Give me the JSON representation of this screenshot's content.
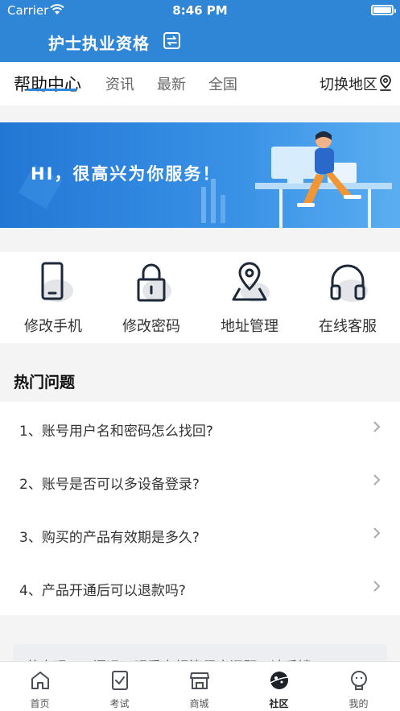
{
  "status_bar": {
    "carrier": "Carrier",
    "time": "8:46 PM"
  },
  "header": {
    "title": "护士执业资格"
  },
  "tabs": {
    "items": [
      {
        "label": "帮助中心"
      },
      {
        "label": "资讯"
      },
      {
        "label": "最新"
      },
      {
        "label": "全国"
      }
    ],
    "region_label": "切换地区"
  },
  "banner": {
    "text": "HI，很高兴为你服务！"
  },
  "actions": [
    {
      "label": "修改手机",
      "icon": "phone-icon"
    },
    {
      "label": "修改密码",
      "icon": "lock-icon"
    },
    {
      "label": "地址管理",
      "icon": "location-icon"
    },
    {
      "label": "在线客服",
      "icon": "headset-icon"
    }
  ],
  "hot": {
    "title": "热门问题",
    "questions": [
      "1、账号用户名和密码怎么找回?",
      "2、账号是否可以多设备登录?",
      "3、购买的产品有效期是多久?",
      "4、产品开通后可以退款吗?"
    ]
  },
  "notice": {
    "text": "若出现APP闪退、观看卡顿等程序问题，请反馈"
  },
  "bottom_nav": [
    {
      "label": "首页"
    },
    {
      "label": "考试"
    },
    {
      "label": "商城"
    },
    {
      "label": "社区"
    },
    {
      "label": "我的"
    }
  ],
  "colors": {
    "primary": "#2f86d6",
    "background": "#f4f4f5"
  }
}
